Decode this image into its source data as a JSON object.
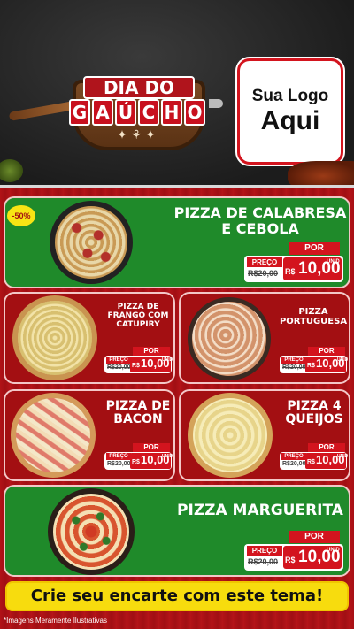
{
  "header": {
    "logo_title_line1": "DIA DO",
    "logo_title_line2_letters": [
      "G",
      "A",
      "Ú",
      "C",
      "H",
      "O"
    ],
    "your_logo_line1": "Sua Logo",
    "your_logo_line2": "Aqui"
  },
  "badge": {
    "discount": "-50%"
  },
  "products": [
    {
      "name": "PIZZA DE CALABRESA E CEBOLA",
      "por_label": "POR",
      "preco_label": "PREÇO",
      "old_price": "R$20,00",
      "currency": "R$",
      "new_price": "10,00",
      "unit": "UNID"
    },
    {
      "name": "PIZZA DE FRANGO COM CATUPIRY",
      "por_label": "POR",
      "preco_label": "PREÇO",
      "old_price": "R$20,00",
      "currency": "R$",
      "new_price": "10,00",
      "unit": "UNID"
    },
    {
      "name": "PIZZA PORTUGUESA",
      "por_label": "POR",
      "preco_label": "PREÇO",
      "old_price": "R$20,00",
      "currency": "R$",
      "new_price": "10,00",
      "unit": "UNID"
    },
    {
      "name": "PIZZA DE BACON",
      "por_label": "POR",
      "preco_label": "PREÇO",
      "old_price": "R$20,00",
      "currency": "R$",
      "new_price": "10,00",
      "unit": "UNID"
    },
    {
      "name": "PIZZA 4 QUEIJOS",
      "por_label": "POR",
      "preco_label": "PREÇO",
      "old_price": "R$20,00",
      "currency": "R$",
      "new_price": "10,00",
      "unit": "UNID"
    },
    {
      "name": "PIZZA MARGUERITA",
      "por_label": "POR",
      "preco_label": "PREÇO",
      "old_price": "R$20,00",
      "currency": "R$",
      "new_price": "10,00",
      "unit": "UNID"
    }
  ],
  "cta": {
    "text": "Crie seu encarte com este tema!"
  },
  "footer": {
    "disclaimer": "*Imagens Meramente Ilustrativas"
  },
  "colors": {
    "brand_red": "#d3141e",
    "card_green": "#1f8a2a",
    "card_red": "#a30f12",
    "cta_yellow": "#f7dc0e"
  }
}
